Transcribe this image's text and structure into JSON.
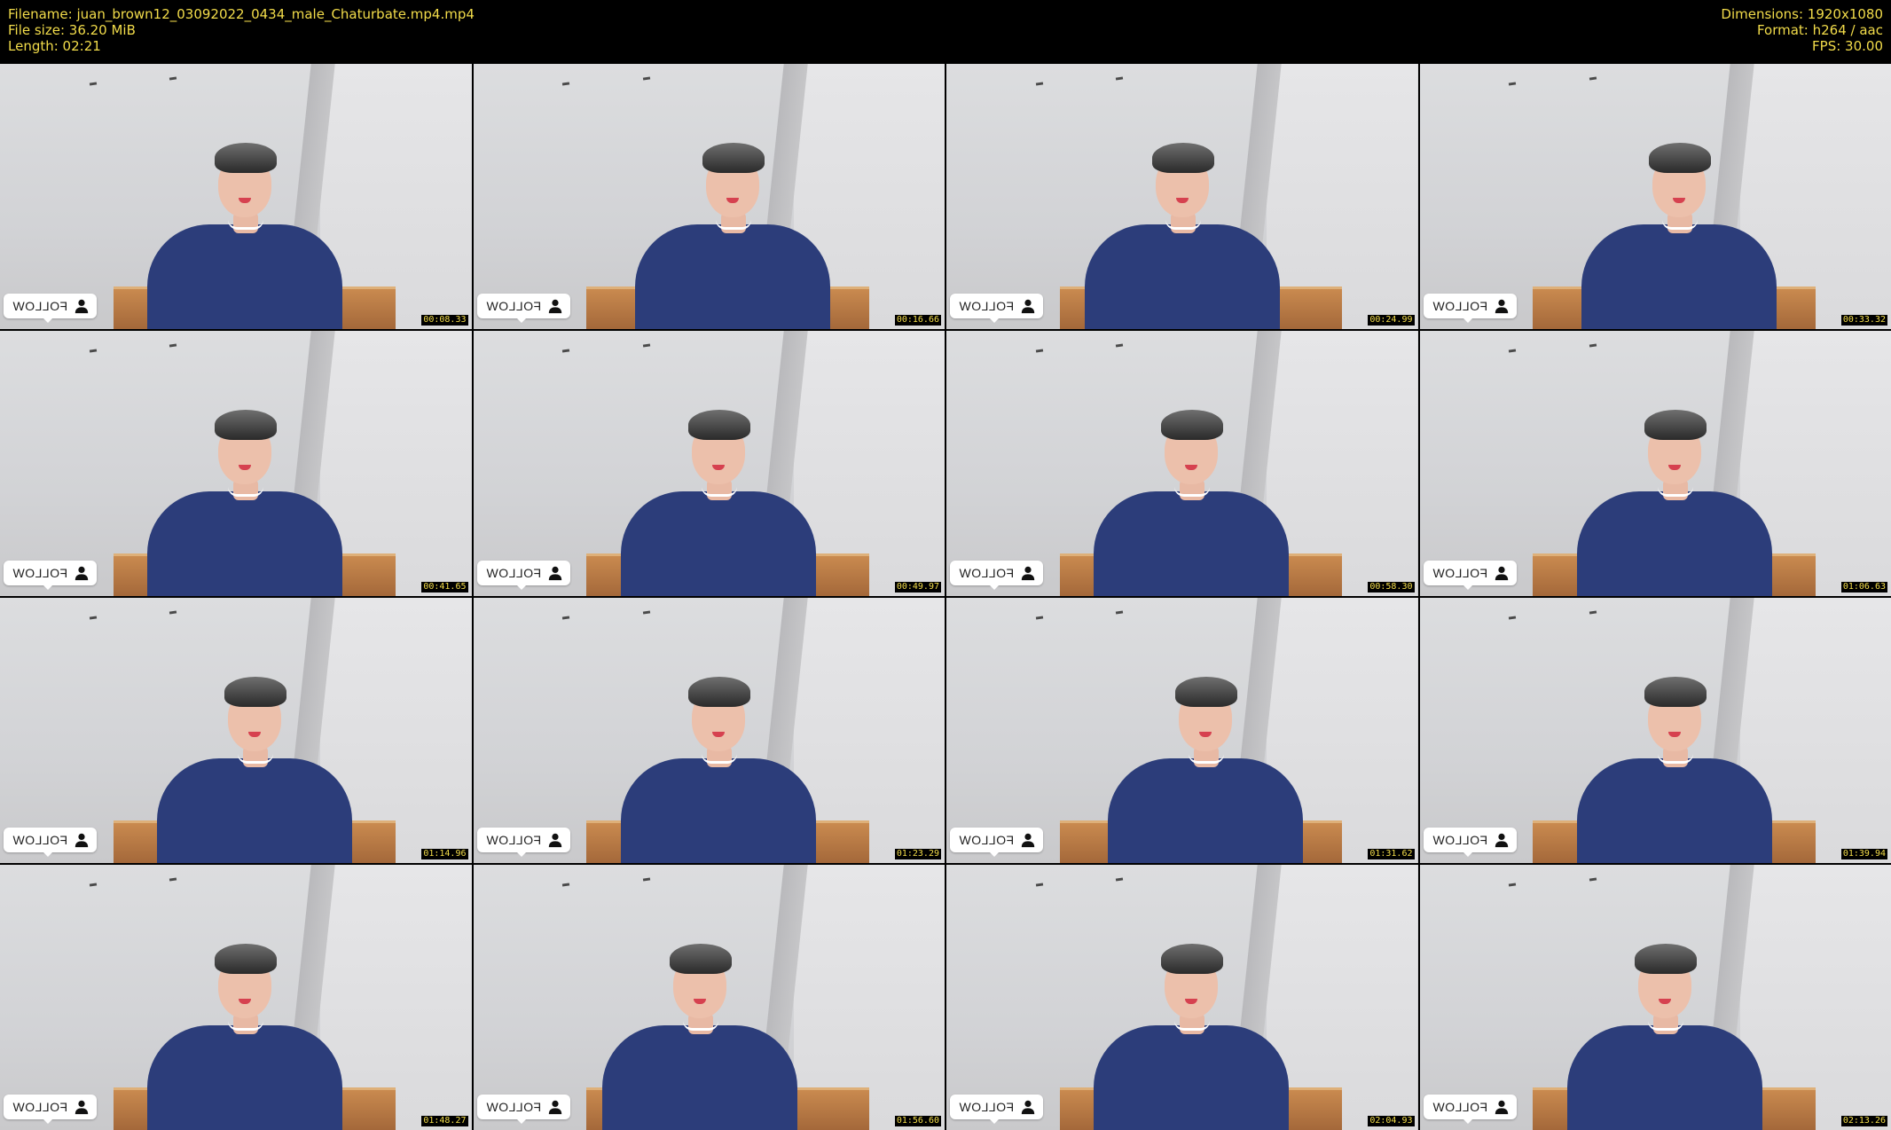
{
  "header": {
    "filename_line": "Filename: juan_brown12_03092022_0434_male_Chaturbate.mp4.mp4",
    "filesize_line": "File size: 36.20 MiB",
    "length_line": "Length: 02:21",
    "dimensions_line": "Dimensions: 1920x1080",
    "format_line": "Format: h264 / aac",
    "fps_line": "FPS: 30.00"
  },
  "colors": {
    "meta_text": "#f2dc4a",
    "shirt": "#2c3d7a",
    "background": "#000000"
  },
  "overlay": {
    "follow_label": "FOLLOW",
    "follow_icon": "user-icon"
  },
  "thumbnails": [
    {
      "timestamp": "00:08.33"
    },
    {
      "timestamp": "00:16.66"
    },
    {
      "timestamp": "00:24.99"
    },
    {
      "timestamp": "00:33.32"
    },
    {
      "timestamp": "00:41.65"
    },
    {
      "timestamp": "00:49.97"
    },
    {
      "timestamp": "00:58.30"
    },
    {
      "timestamp": "01:06.63"
    },
    {
      "timestamp": "01:14.96"
    },
    {
      "timestamp": "01:23.29"
    },
    {
      "timestamp": "01:31.62"
    },
    {
      "timestamp": "01:39.94"
    },
    {
      "timestamp": "01:48.27"
    },
    {
      "timestamp": "01:56.60"
    },
    {
      "timestamp": "02:04.93"
    },
    {
      "timestamp": "02:13.26"
    }
  ]
}
